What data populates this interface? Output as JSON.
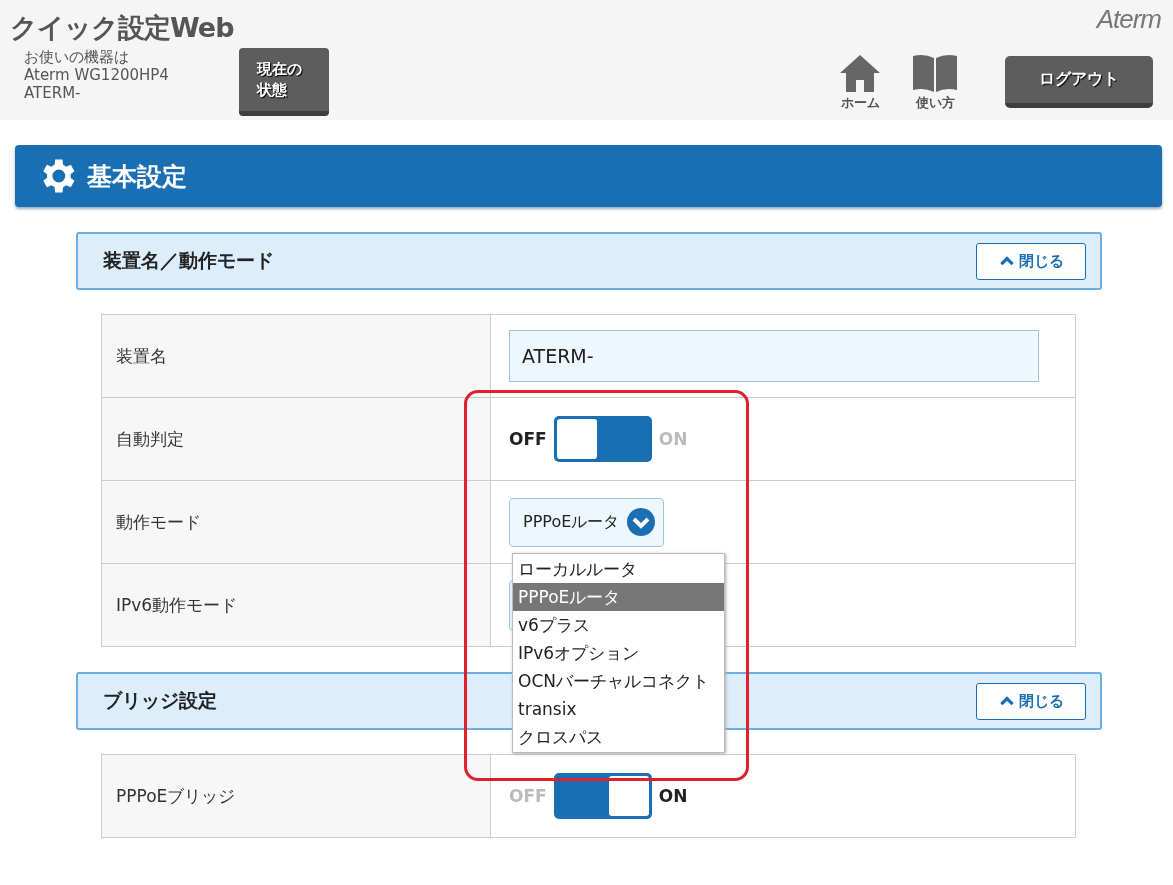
{
  "header": {
    "title": "クイック設定Web",
    "device_lines": [
      "お使いの機器は",
      "Aterm WG1200HP4",
      "ATERM-"
    ],
    "status_button": [
      "現在の",
      "状態"
    ],
    "logo": "Aterm",
    "nav": [
      {
        "kind": "home",
        "label": "ホーム"
      },
      {
        "kind": "book",
        "label": "使い方"
      }
    ],
    "logout": "ログアウト"
  },
  "page_title": "基本設定",
  "sections": [
    {
      "title": "装置名／動作モード",
      "close_label": "閉じる",
      "rows": [
        {
          "kind": "text",
          "label": "装置名",
          "value": "ATERM-"
        },
        {
          "kind": "toggle",
          "label": "自動判定",
          "off_label": "OFF",
          "on_label": "ON",
          "on": false
        },
        {
          "kind": "select",
          "label": "動作モード",
          "value": "PPPoEルータ",
          "open": true,
          "options": [
            {
              "label": "ローカルルータ",
              "selected": false
            },
            {
              "label": "PPPoEルータ",
              "selected": true
            },
            {
              "label": "v6プラス",
              "selected": false
            },
            {
              "label": "IPv6オプション",
              "selected": false
            },
            {
              "label": "OCNバーチャルコネクト",
              "selected": false
            },
            {
              "label": "transix",
              "selected": false
            },
            {
              "label": "クロスパス",
              "selected": false
            }
          ]
        },
        {
          "kind": "covered",
          "label": "IPv6動作モード"
        }
      ]
    },
    {
      "title": "ブリッジ設定",
      "close_label": "閉じる",
      "rows": [
        {
          "kind": "toggle",
          "label": "PPPoEブリッジ",
          "off_label": "OFF",
          "on_label": "ON",
          "on": true
        }
      ]
    }
  ],
  "annotation": {
    "kind": "red_frame"
  }
}
